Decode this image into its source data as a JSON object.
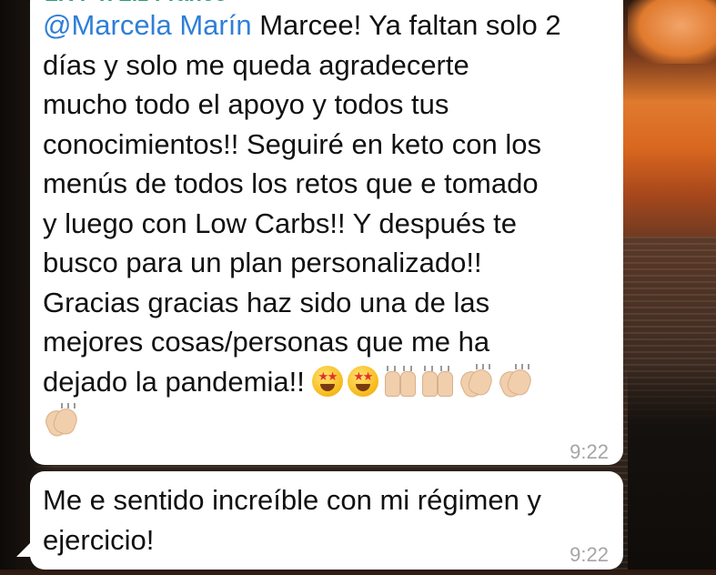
{
  "chat": {
    "messages": [
      {
        "sender": "LR P x Liz Franco",
        "mention": "@Marcela Marín",
        "lines": [
          " Marcee! Ya faltan solo 2",
          "días y solo me queda agradecerte",
          "mucho todo el apoyo y todos tus",
          "conocimientos!! Seguiré en keto con los",
          "menús de todos los retos que e tomado",
          "y luego con Low Carbs!! Y después te",
          "busco para un plan personalizado!!",
          "Gracias gracias haz sido una de las",
          "mejores cosas/personas que me ha",
          "dejado la pandemia!! "
        ],
        "emojis": [
          "star-struck-emoji",
          "star-struck-emoji",
          "raising-hands-emoji",
          "raising-hands-emoji",
          "clapping-hands-emoji",
          "clapping-hands-emoji",
          "clapping-hands-emoji"
        ],
        "time": "9:22"
      },
      {
        "lines": [
          "Me e sentido increíble con mi régimen y",
          "ejercicio!"
        ],
        "time": "9:22"
      }
    ]
  },
  "colors": {
    "bubble": "#ffffff",
    "mention": "#2f7fd6",
    "sender": "#2e9e77",
    "timestamp": "#a5a5a5"
  }
}
